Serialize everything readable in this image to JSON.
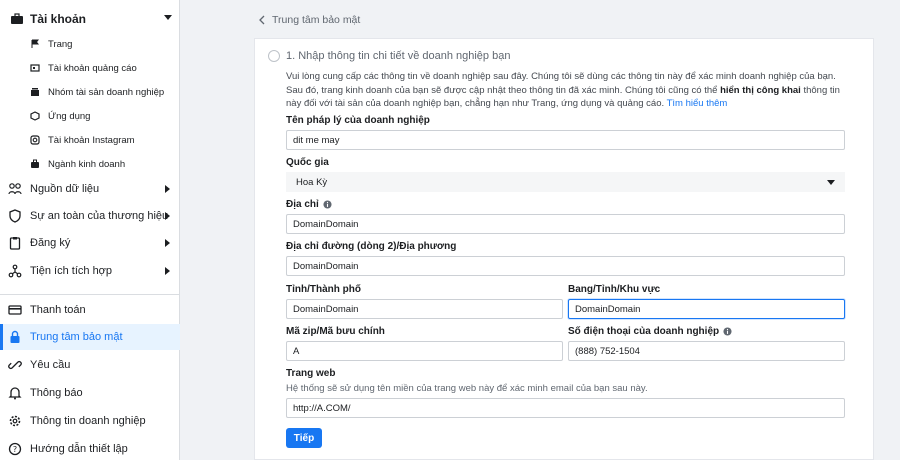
{
  "sidebar": {
    "account_header": "Tài khoản",
    "sub_items": [
      {
        "label": "Trang",
        "icon": "flag-icon"
      },
      {
        "label": "Tài khoản quảng cáo",
        "icon": "ad-account-icon"
      },
      {
        "label": "Nhóm tài sản doanh nghiệp",
        "icon": "asset-group-icon"
      },
      {
        "label": "Ứng dụng",
        "icon": "app-cube-icon"
      },
      {
        "label": "Tài khoản Instagram",
        "icon": "instagram-icon"
      },
      {
        "label": "Ngành kinh doanh",
        "icon": "briefcase-icon"
      }
    ],
    "main_items": [
      {
        "label": "Nguồn dữ liệu",
        "icon": "data-source-icon",
        "has_arrow": true
      },
      {
        "label": "Sự an toàn của thương hiệu",
        "icon": "shield-icon",
        "has_arrow": true
      },
      {
        "label": "Đăng ký",
        "icon": "clipboard-icon",
        "has_arrow": true
      },
      {
        "label": "Tiện ích tích hợp",
        "icon": "integration-icon",
        "has_arrow": true
      },
      {
        "label": "Thanh toán",
        "icon": "card-icon",
        "has_arrow": false
      },
      {
        "label": "Trung tâm bảo mật",
        "icon": "lock-icon",
        "has_arrow": false,
        "active": true
      },
      {
        "label": "Yêu cầu",
        "icon": "link-icon",
        "has_arrow": false
      },
      {
        "label": "Thông báo",
        "icon": "bell-icon",
        "has_arrow": false
      },
      {
        "label": "Thông tin doanh nghiệp",
        "icon": "gear-icon",
        "has_arrow": false
      },
      {
        "label": "Hướng dẫn thiết lập",
        "icon": "help-icon",
        "has_arrow": false
      }
    ]
  },
  "breadcrumb": {
    "back_label": "Trung tâm bảo mật"
  },
  "step": {
    "title": "1. Nhập thông tin chi tiết về doanh nghiệp bạn",
    "desc_part1": "Vui lòng cung cấp các thông tin về doanh nghiệp sau đây. Chúng tôi sẽ dùng các thông tin này để xác minh doanh nghiệp của bạn. Sau đó, trang kinh doanh của bạn sẽ được cập nhật theo thông tin đã xác minh. Chúng tôi cũng có thể ",
    "desc_bold": "hiển thị công khai",
    "desc_part2": " thông tin này đối với tài sản của doanh nghiệp bạn, chẳng hạn như Trang, ứng dụng và quảng cáo. ",
    "desc_link": "Tìm hiểu thêm"
  },
  "form": {
    "legal_name_label": "Tên pháp lý của doanh nghiệp",
    "legal_name_value": "dit me may",
    "country_label": "Quốc gia",
    "country_value": "Hoa Kỳ",
    "address_label": "Địa chỉ",
    "address_value": "DomainDomain",
    "address2_label": "Địa chỉ đường (dòng 2)/Địa phương",
    "address2_value": "DomainDomain",
    "city_label": "Tỉnh/Thành phố",
    "city_value": "DomainDomain",
    "state_label": "Bang/Tỉnh/Khu vực",
    "state_value": "DomainDomain",
    "zip_label": "Mã zip/Mã bưu chính",
    "zip_value": "A",
    "phone_label": "Số điện thoại của doanh nghiệp",
    "phone_value": "(888) 752-1504",
    "website_label": "Trang web",
    "website_hint": "Hệ thống sẽ sử dụng tên miền của trang web này để xác minh email của bạn sau này.",
    "website_value": "http://A.COM/",
    "next_label": "Tiếp"
  },
  "colors": {
    "accent": "#1877f2",
    "active_bg": "#e7f3ff"
  }
}
